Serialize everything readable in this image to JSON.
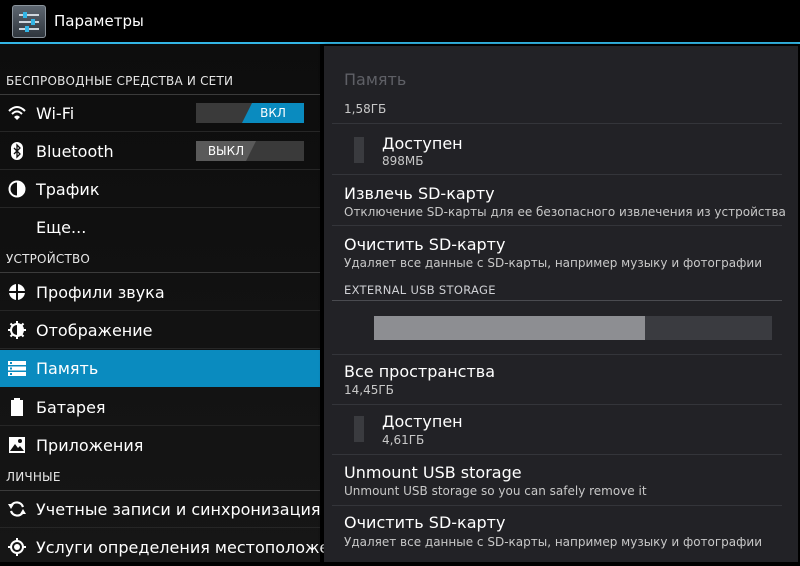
{
  "app": {
    "title": "Параметры"
  },
  "sidebar": {
    "sections": [
      {
        "header": "БЕСПРОВОДНЫЕ СРЕДСТВА И СЕТИ"
      },
      {
        "header": "УСТРОЙСТВО"
      },
      {
        "header": "ЛИЧНЫЕ"
      }
    ],
    "items": [
      {
        "label": "Wi-Fi",
        "icon": "wifi-icon",
        "toggle": "ВКЛ"
      },
      {
        "label": "Bluetooth",
        "icon": "bluetooth-icon",
        "toggle": "ВЫКЛ"
      },
      {
        "label": "Трафик",
        "icon": "data-usage-icon"
      },
      {
        "label": "Еще..."
      },
      {
        "label": "Профили звука",
        "icon": "sound-icon"
      },
      {
        "label": "Отображение",
        "icon": "display-icon"
      },
      {
        "label": "Память",
        "icon": "storage-icon",
        "selected": true
      },
      {
        "label": "Батарея",
        "icon": "battery-icon"
      },
      {
        "label": "Приложения",
        "icon": "apps-icon"
      },
      {
        "label": "Учетные записи и синхронизация",
        "icon": "sync-icon"
      },
      {
        "label": "Услуги определения местоположе",
        "icon": "location-icon"
      }
    ],
    "colors": {
      "selected": "#0a8bbf",
      "accent": "#33b5e5"
    }
  },
  "main": {
    "title": "Память",
    "top_value": "1,58ГБ",
    "sd_available": {
      "label": "Доступен",
      "value": "898МБ"
    },
    "sd_unmount": {
      "label": "Извлечь SD-карту",
      "sub": "Отключение SD-карты для ее безопасного извлечения из устройства"
    },
    "sd_erase": {
      "label": "Очистить SD-карту",
      "sub": "Удаляет все данные с SD-карты, например музыку и фотографии"
    },
    "usb_header": "EXTERNAL USB STORAGE",
    "usb_used_fraction": 0.68,
    "usb_total": {
      "label": "Все пространства",
      "value": "14,45ГБ"
    },
    "usb_available": {
      "label": "Доступен",
      "value": "4,61ГБ"
    },
    "usb_unmount": {
      "label": "Unmount USB storage",
      "sub": "Unmount USB storage so you can safely remove it"
    },
    "usb_erase": {
      "label": "Очистить SD-карту",
      "sub": "Удаляет все данные с SD-карты, например музыку и фотографии"
    }
  }
}
